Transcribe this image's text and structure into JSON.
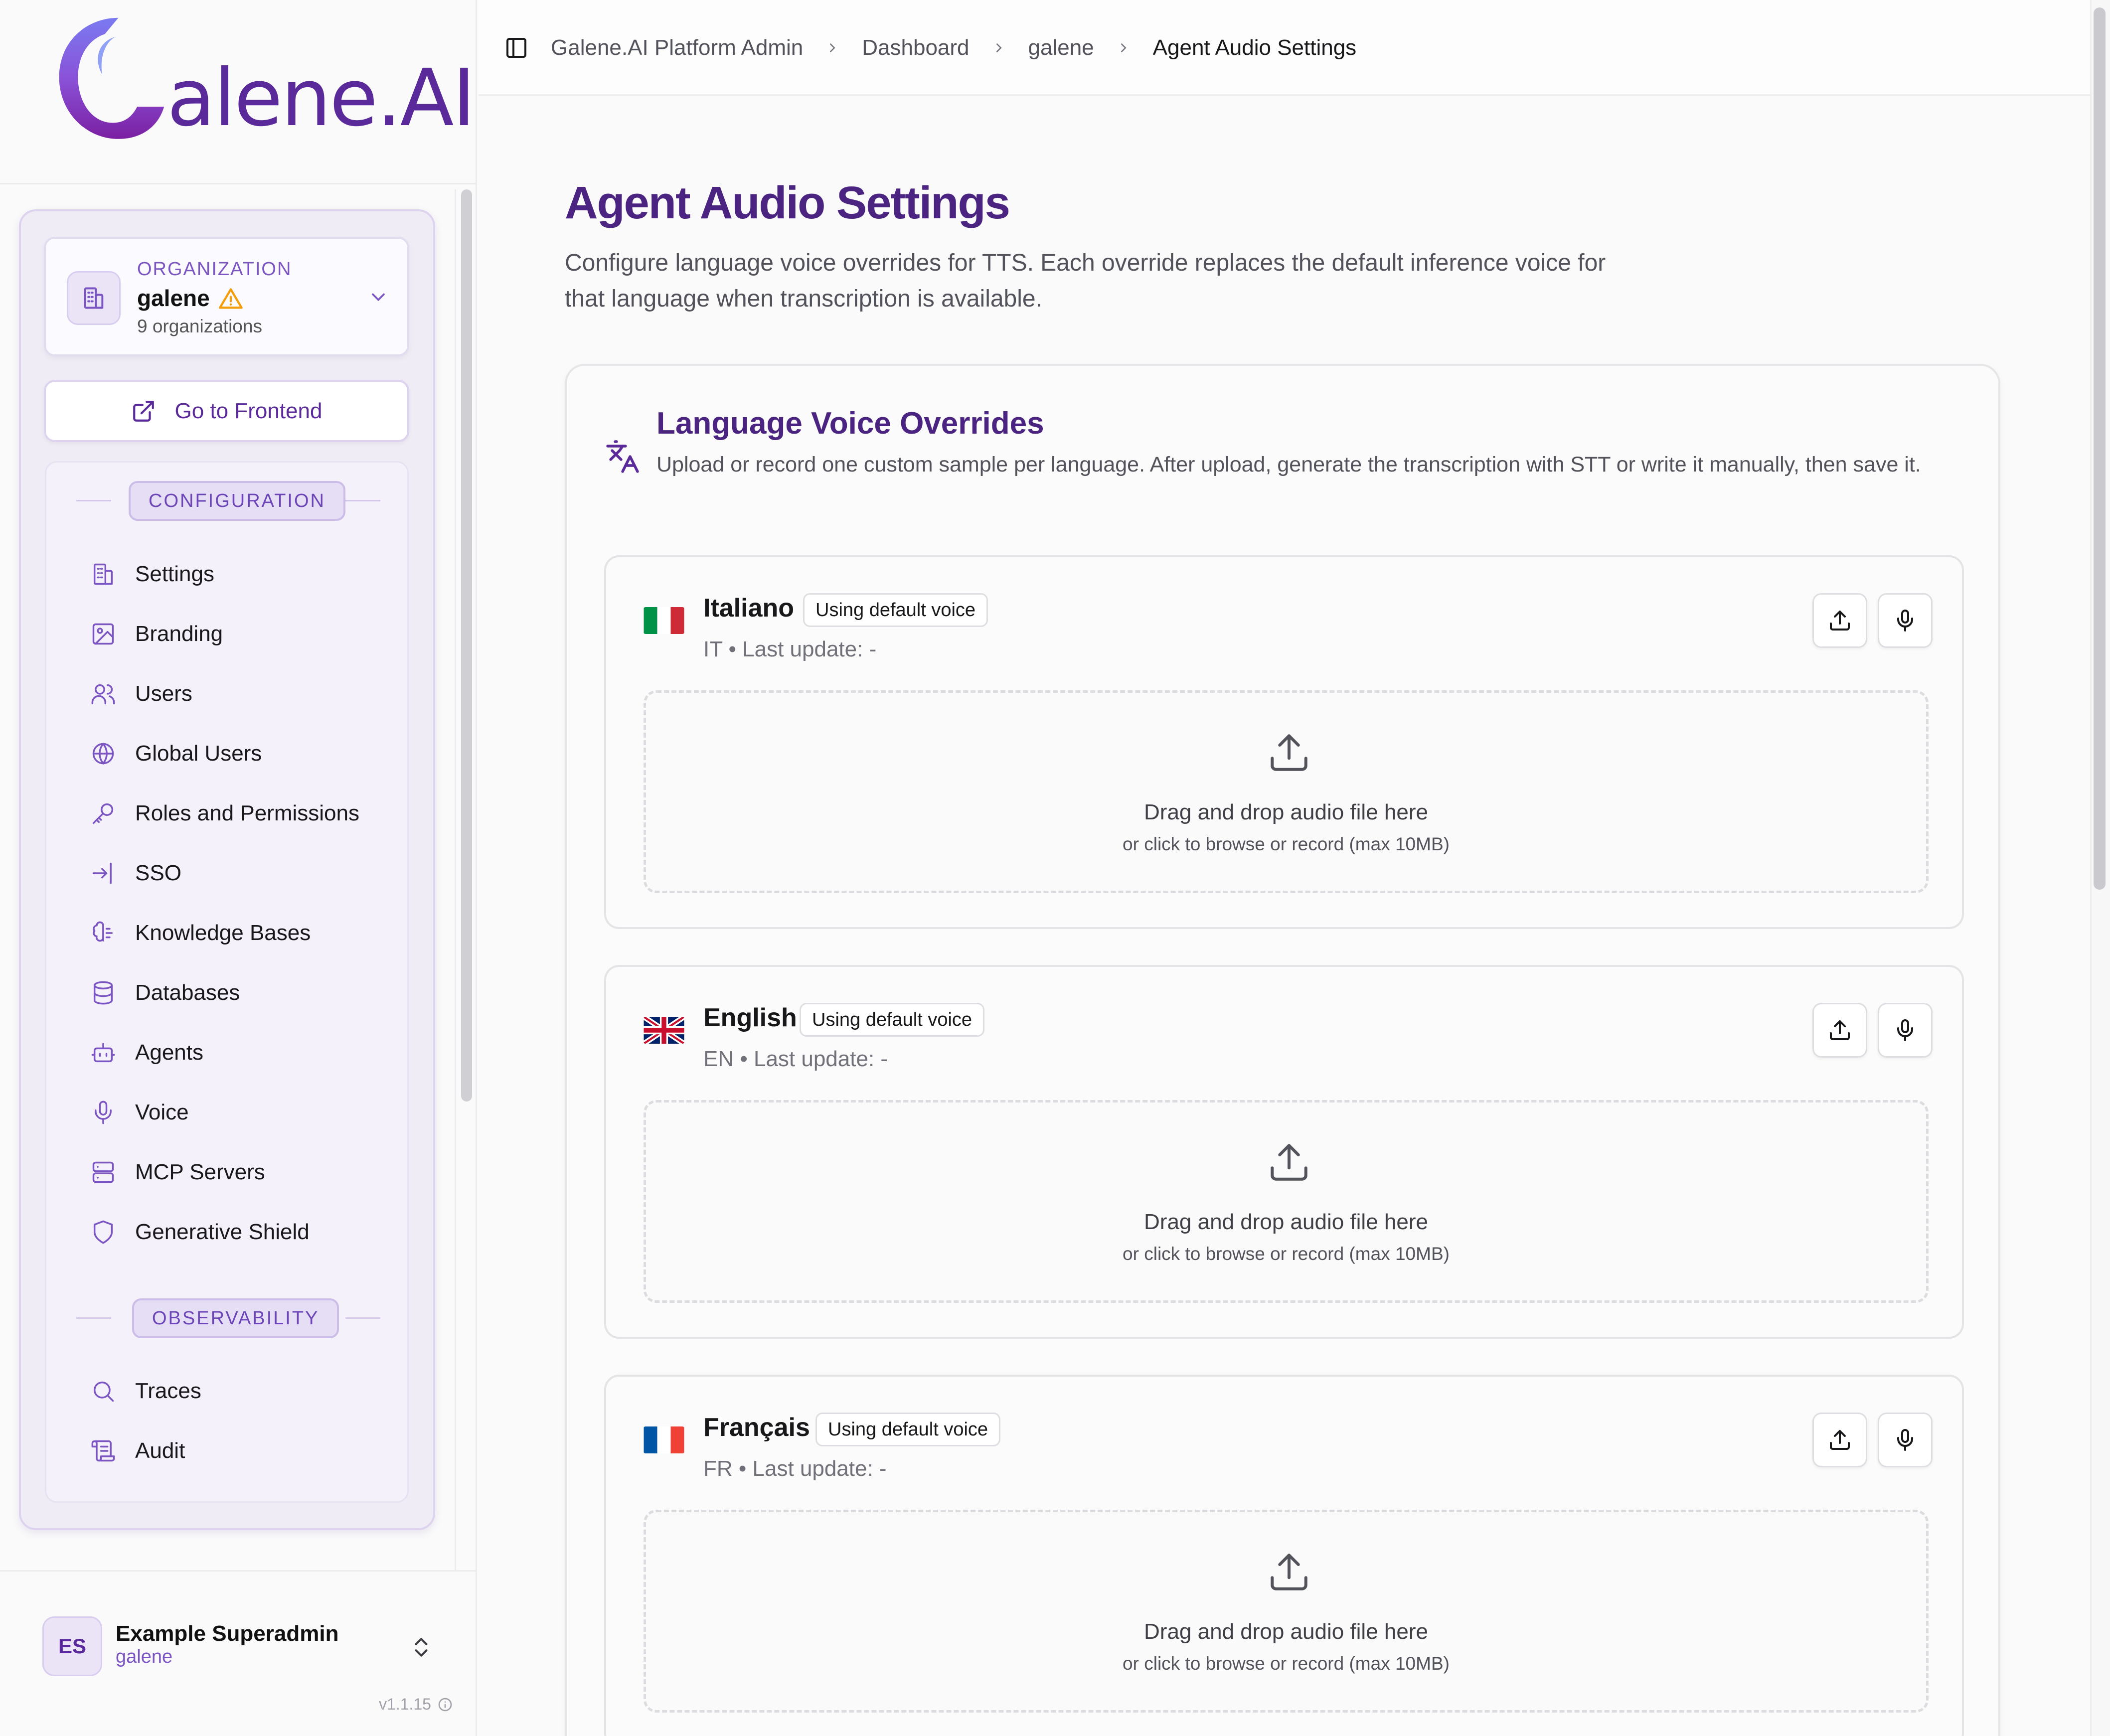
{
  "brand": {
    "name": "alene.AI"
  },
  "organization": {
    "label": "ORGANIZATION",
    "name": "galene",
    "count": "9 organizations"
  },
  "sidebar": {
    "frontend_button": "Go to Frontend",
    "sections": [
      {
        "title": "CONFIGURATION",
        "items": [
          {
            "label": "Settings",
            "icon": "building-icon"
          },
          {
            "label": "Branding",
            "icon": "image-icon"
          },
          {
            "label": "Users",
            "icon": "users-icon"
          },
          {
            "label": "Global Users",
            "icon": "globe-icon"
          },
          {
            "label": "Roles and Permissions",
            "icon": "key-icon"
          },
          {
            "label": "SSO",
            "icon": "login-icon"
          },
          {
            "label": "Knowledge Bases",
            "icon": "brain-icon"
          },
          {
            "label": "Databases",
            "icon": "database-icon"
          },
          {
            "label": "Agents",
            "icon": "bot-icon"
          },
          {
            "label": "Voice",
            "icon": "mic-icon"
          },
          {
            "label": "MCP Servers",
            "icon": "server-icon"
          },
          {
            "label": "Generative Shield",
            "icon": "shield-icon"
          }
        ]
      },
      {
        "title": "OBSERVABILITY",
        "items": [
          {
            "label": "Traces",
            "icon": "search-icon"
          },
          {
            "label": "Audit",
            "icon": "scroll-icon"
          }
        ]
      }
    ]
  },
  "user": {
    "initials": "ES",
    "name": "Example Superadmin",
    "org": "galene",
    "version": "v1.1.15"
  },
  "breadcrumb": [
    "Galene.AI Platform Admin",
    "Dashboard",
    "galene",
    "Agent Audio Settings"
  ],
  "page": {
    "title": "Agent Audio Settings",
    "description_line1": "Configure language voice overrides for TTS. Each override replaces the default inference voice for",
    "description_line2": "that language when transcription is available."
  },
  "card": {
    "title": "Language Voice Overrides",
    "description": "Upload or record one custom sample per language. After upload, generate the transcription with STT or write it manually, then save it."
  },
  "languages": [
    {
      "name": "Italiano",
      "badge": "Using default voice",
      "meta": "IT • Last update: -",
      "flag": "italy-flag"
    },
    {
      "name": "English",
      "badge": "Using default voice",
      "meta": "EN • Last update: -",
      "flag": "uk-flag"
    },
    {
      "name": "Français",
      "badge": "Using default voice",
      "meta": "FR • Last update: -",
      "flag": "france-flag"
    }
  ],
  "dropzone": {
    "title": "Drag and drop audio file here",
    "subtitle": "or click to browse or record (max 10MB)"
  },
  "colors": {
    "accent": "#5b2a9a",
    "title": "#4a2480",
    "warning": "#f59e0b"
  }
}
